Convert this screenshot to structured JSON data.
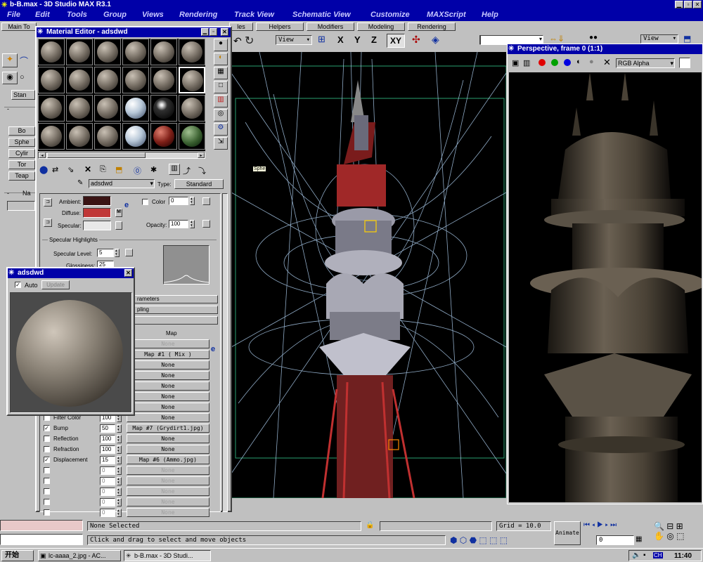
{
  "app": {
    "title": "b-B.max - 3D Studio MAX R3.1"
  },
  "menu": [
    "File",
    "Edit",
    "Tools",
    "Group",
    "Views",
    "Rendering",
    "Track View",
    "Schematic View",
    "Customize",
    "MAXScript",
    "Help"
  ],
  "tabs": {
    "main": "Main To",
    "partial": "les",
    "items": [
      "Helpers",
      "Modifiers",
      "Modeling",
      "Rendering"
    ]
  },
  "toolbar": {
    "view1": "View",
    "view2": "View",
    "xy": "XY",
    "axes": [
      "X",
      "Y",
      "Z"
    ]
  },
  "left_panel": {
    "stan": "Stan",
    "items": [
      "Bo",
      "Sphe",
      "Cylir",
      "Tor",
      "Teap"
    ],
    "na": "Na",
    "sph_tag": "Sphe"
  },
  "material_editor": {
    "title": "Material Editor - adsdwd",
    "name": "adsdwd",
    "type_label": "Type:",
    "type_value": "Standard",
    "ambient": "Ambient:",
    "diffuse": "Diffuse:",
    "specular": "Specular:",
    "color_label": "Color",
    "color_value": "0",
    "opacity_label": "Opacity:",
    "opacity_value": "100",
    "specular_highlights": "Specular Highlights",
    "specular_level_label": "Specular Level:",
    "specular_level_value": "5",
    "glossiness_label": "Glossiness:",
    "glossiness_value": "25",
    "rollouts": [
      "rameters",
      "pling"
    ],
    "map_header": "Map",
    "map_rows": [
      {
        "label": "",
        "amount": "",
        "map": "None",
        "disabled": true
      },
      {
        "label": "",
        "amount": "",
        "map": "Map #1  ( Mix )",
        "checked": true
      },
      {
        "label": "",
        "amount": "",
        "map": "None"
      },
      {
        "label": "",
        "amount": "",
        "map": "None"
      },
      {
        "label": "",
        "amount": "",
        "map": "None"
      },
      {
        "label": "",
        "amount": "",
        "map": "None"
      },
      {
        "label": "",
        "amount": "",
        "map": "None"
      },
      {
        "label": "Filter Color",
        "amount": "100",
        "map": "None"
      },
      {
        "label": "Bump",
        "amount": "50",
        "map": "Map #7 (Grydirt1.jpg)",
        "checked": true
      },
      {
        "label": "Reflection",
        "amount": "100",
        "map": "None"
      },
      {
        "label": "Refraction",
        "amount": "100",
        "map": "None"
      },
      {
        "label": "Displacement",
        "amount": "15",
        "map": "Map #6 (Ammo.jpg)",
        "checked": true
      },
      {
        "label": "",
        "amount": "0",
        "map": "None",
        "disabled": true
      },
      {
        "label": "",
        "amount": "0",
        "map": "None",
        "disabled": true
      },
      {
        "label": "",
        "amount": "0",
        "map": "None",
        "disabled": true
      },
      {
        "label": "",
        "amount": "0",
        "map": "None",
        "disabled": true
      },
      {
        "label": "",
        "amount": "0",
        "map": "None",
        "disabled": true
      }
    ]
  },
  "sample_window": {
    "title": "adsdwd",
    "auto": "Auto",
    "update": "Update"
  },
  "vfb": {
    "title": "Perspective, frame 0 (1:1)",
    "channel": "RGB Alpha"
  },
  "status": {
    "selection": "None Selected",
    "prompt": "Click and drag to select and move objects",
    "grid": "Grid = 10.0",
    "animate": "Animate",
    "frame": "0"
  },
  "taskbar": {
    "start": "开始",
    "tasks": [
      "lc-aaaa_2.jpg - AC...",
      "b-B.max - 3D Studi..."
    ],
    "clock": "11:40",
    "tray": "CH"
  },
  "colors": {
    "titlebar": "#0000a8",
    "ambient": "#3a1414",
    "diffuse": "#c03838",
    "specular": "#e8e8e8"
  }
}
